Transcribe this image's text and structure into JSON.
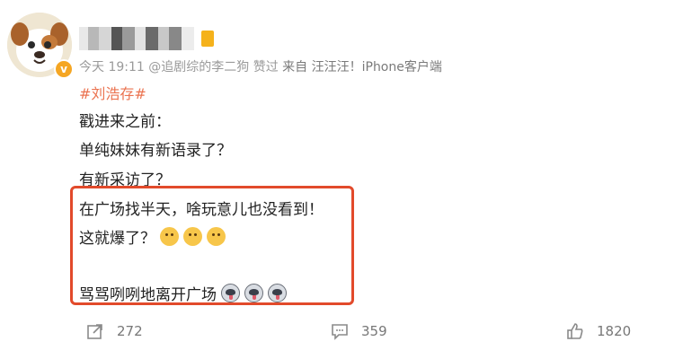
{
  "post": {
    "meta": {
      "time": "今天 19:11",
      "liked_by": "@追剧综的李二狗 赞过",
      "source": "来自 汪汪汪！iPhone客户端"
    },
    "hashtag": "#刘浩存#",
    "lines": [
      "戳进来之前：",
      "单纯妹妹有新语录了？",
      "有新采访了？",
      "在广场找半天，啥玩意儿也没看到！",
      "这就爆了？",
      "骂骂咧咧地离开广场"
    ]
  },
  "actions": {
    "repost_count": "272",
    "comment_count": "359",
    "like_count": "1820"
  },
  "icons": {
    "avatar": "dog-avatar",
    "verified": "verified-v-icon",
    "member": "member-icon",
    "repost": "repost-icon",
    "comment": "comment-icon",
    "like": "thumbs-up-icon",
    "emoji_row1": "dog-face-emoji",
    "emoji_row2": "husky-face-emoji"
  },
  "colors": {
    "hashtag": "#eb7350",
    "highlight_box": "#e24a2b",
    "meta_text": "#9a9a9a"
  }
}
